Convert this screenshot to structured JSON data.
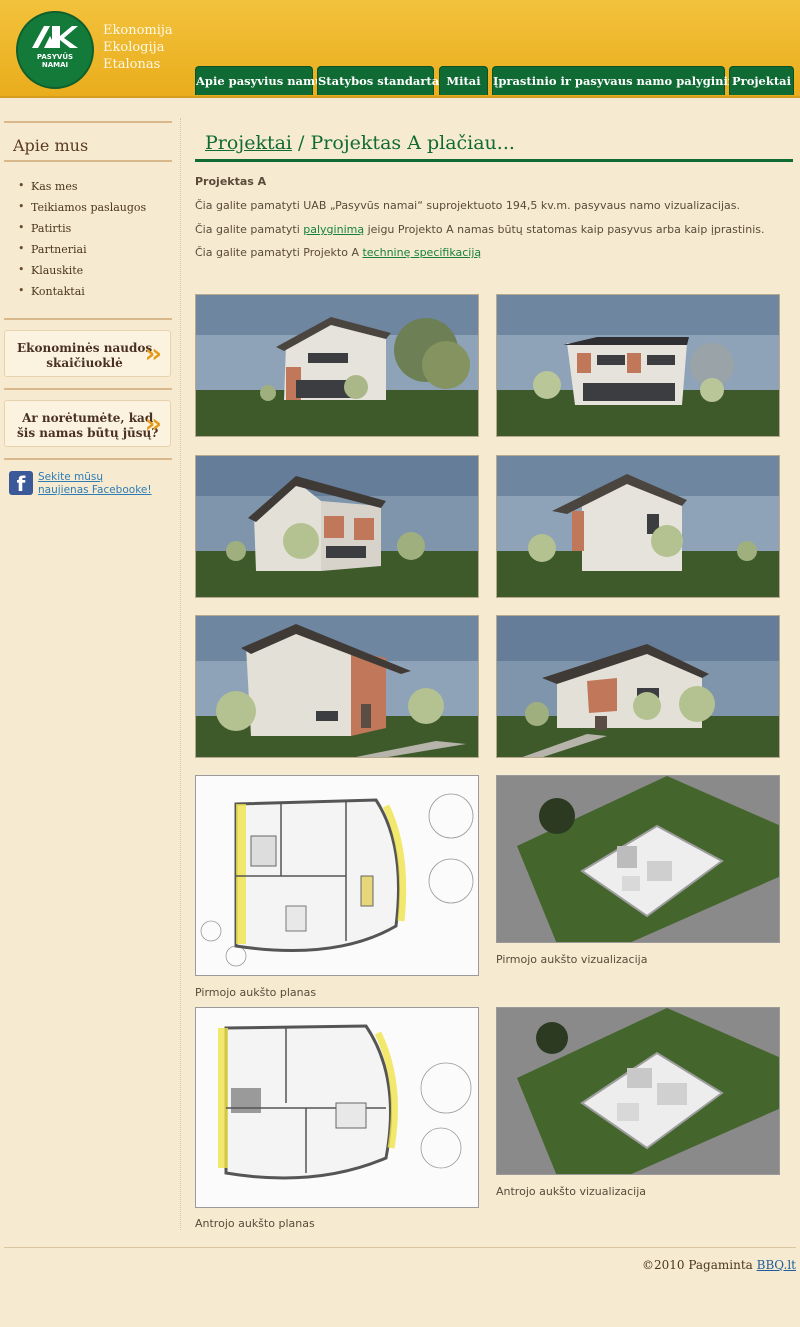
{
  "logo": {
    "line1": "PASYVŪS",
    "line2": "NAMAI"
  },
  "tagline": [
    "Ekonomija",
    "Ekologija",
    "Etalonas"
  ],
  "nav": [
    "Apie pasyvius namus",
    "Statybos standartai",
    "Mitai",
    "Įprastinio ir pasyvaus namo palyginimas",
    "Projektai"
  ],
  "sidebar": {
    "title": "Apie mus",
    "menu": [
      "Kas mes",
      "Teikiamos paslaugos",
      "Patirtis",
      "Partneriai",
      "Klauskite",
      "Kontaktai"
    ],
    "box1": {
      "line1": "Ekonominės naudos",
      "line2": "skaičiuoklė"
    },
    "box2": {
      "line1": "Ar norėtumėte, kad",
      "line2": "šis namas būtų jūsų?"
    },
    "facebook": {
      "line1": "Sekite mūsų",
      "line2": "naujienas Facebooke!"
    }
  },
  "main": {
    "breadcrumb": "Projektai",
    "title_rest": " / Projektas A plačiau...",
    "heading": "Projektas A",
    "p1": "Čia galite pamatyti UAB „Pasyvūs namai“ suprojektuoto 194,5 kv.m. pasyvaus namo vizualizacijas.",
    "p2_before": "Čia galite pamatyti ",
    "p2_link": "palyginimą",
    "p2_after": " jeigu Projekto A namas būtų statomas kaip pasyvus arba kaip įprastinis.",
    "p3_before": "Čia galite pamatyti Projekto A ",
    "p3_link": "techninę specifikaciją",
    "captions": {
      "floor1_view": "Pirmojo aukšto vizualizacija",
      "floor1_plan": "Pirmojo aukšto planas",
      "floor2_view": "Antrojo aukšto vizualizacija",
      "floor2_plan": "Antrojo aukšto planas"
    }
  },
  "footer": {
    "copyright": "©2010 Pagaminta ",
    "link": "BBQ.lt"
  },
  "colors": {
    "header": "#f0b829",
    "nav": "#0f6a34",
    "accent_green": "#106a33",
    "chevron": "#e69a1c",
    "background": "#f6ebd0"
  }
}
